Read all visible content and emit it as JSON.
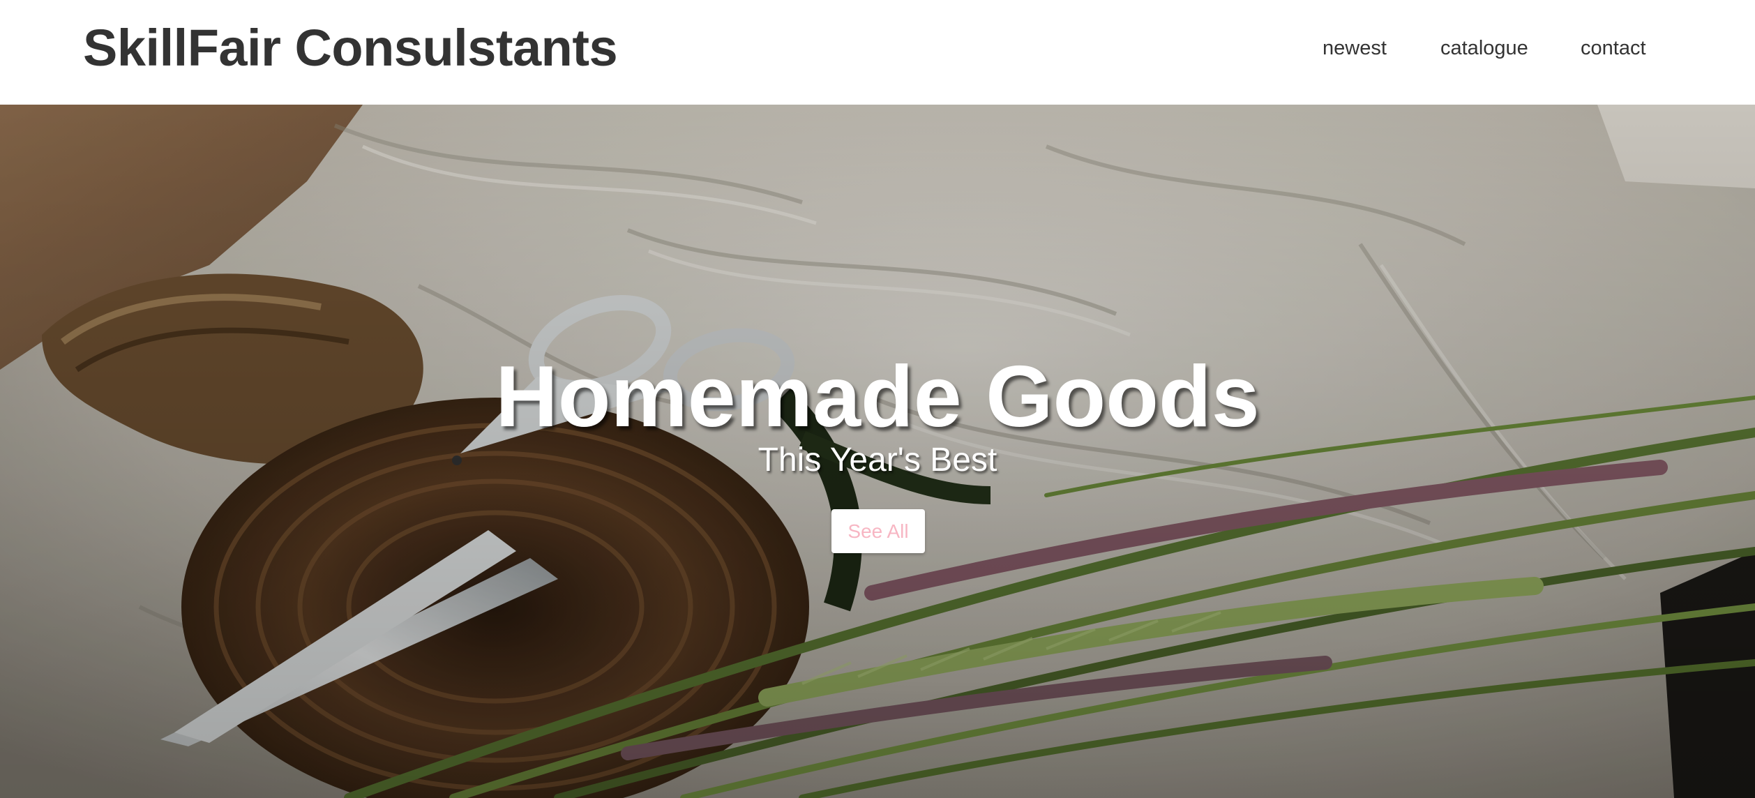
{
  "header": {
    "brand": "SkillFair Consulstants",
    "nav": [
      {
        "label": "newest"
      },
      {
        "label": "catalogue"
      },
      {
        "label": "contact"
      }
    ]
  },
  "hero": {
    "title": "Homemade Goods",
    "subtitle": "This Year's Best",
    "cta_label": "See All",
    "cta_text_color": "#f7b6c3",
    "image_subject": "scissors-twine-wheat-photo"
  }
}
